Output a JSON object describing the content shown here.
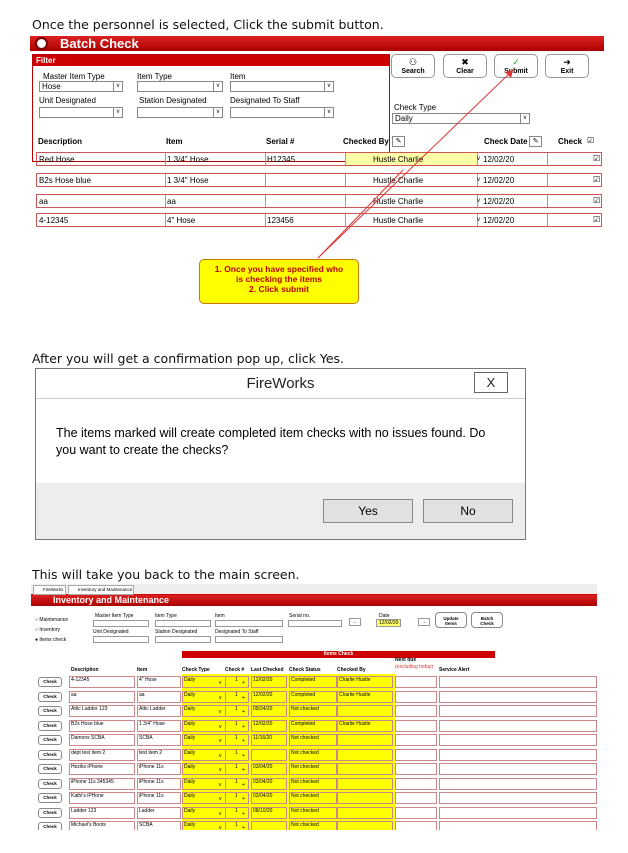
{
  "captions": {
    "c1": "Once the personnel is selected, Click the submit button.",
    "c2": "After you will get a confirmation pop up, click Yes.",
    "c3": "This will take you back to the main screen."
  },
  "batch": {
    "title": "Batch Check",
    "filter_title": "Filter",
    "labels": {
      "master": "Master Item Type",
      "item_type": "Item Type",
      "item": "Item",
      "unit": "Unit Designated",
      "station": "Station Designated",
      "staff": "Designated To Staff",
      "check_type": "Check Type"
    },
    "master_value": "Hose",
    "check_type_value": "Daily",
    "buttons": {
      "search": "Search",
      "clear": "Clear",
      "submit": "Submit",
      "exit": "Exit"
    },
    "headers": {
      "description": "Description",
      "item": "Item",
      "serial": "Serial #",
      "checked_by": "Checked By",
      "check_date": "Check Date",
      "check": "Check"
    },
    "rows": [
      {
        "description": "Red Hose",
        "item": "1 3/4\" Hose",
        "serial": "H12345",
        "checked_by": "Hustle Charlie",
        "date": "12/02/20"
      },
      {
        "description": "B2s Hose blue",
        "item": "1 3/4\" Hose",
        "serial": "",
        "checked_by": "Hustle Charlie",
        "date": "12/02/20"
      },
      {
        "description": "aa",
        "item": "aa",
        "serial": "",
        "checked_by": "Hustle Charlie",
        "date": "12/02/20"
      },
      {
        "description": "4-12345",
        "item": "4\" Hose",
        "serial": "123456",
        "checked_by": "Hustle Charlie",
        "date": "12/02/20"
      }
    ],
    "callout": {
      "line1": "1. Once you have specified who",
      "line2": "is checking the items",
      "line3": "2. Click submit"
    }
  },
  "dialog": {
    "title": "FireWorks",
    "close": "X",
    "message": "The items marked will create completed item checks with no issues found. Do you want to create the checks?",
    "yes": "Yes",
    "no": "No"
  },
  "main": {
    "tabs": [
      "FireWorks",
      "Inventory and Maintenance"
    ],
    "title": "Inventory and Maintenance",
    "radios": [
      "Maintenance",
      "Inventory",
      "Items check"
    ],
    "labels": {
      "master": "Master Item Type",
      "item_type": "Item Type",
      "item": "Item",
      "serial": "Serial no.",
      "date": "Date",
      "unit": "Unit Designated",
      "station": "Station Designated",
      "staff": "Designated To Staff"
    },
    "date_value": "12/02/20",
    "buttons": {
      "update1": "Update",
      "update2": "Items",
      "batch1": "Batch",
      "batch2": "Check"
    },
    "items_check": "Items Check",
    "headers": {
      "description": "Description",
      "item": "Item",
      "check_type": "Check Type",
      "check_num": "Check #",
      "last": "Last Checked",
      "status": "Check Status",
      "by": "Checked By",
      "next1": "Next due",
      "next2": "(excluding today)",
      "alert": "Service Alert"
    },
    "check_label": "Check",
    "rows": [
      {
        "description": "4-12345",
        "item": "4\" Hose",
        "type": "Daily",
        "num": "1",
        "last": "12/02/20",
        "status": "Completed",
        "by": "Charlie Hustle"
      },
      {
        "description": "aa",
        "item": "aa",
        "type": "Daily",
        "num": "1",
        "last": "12/02/20",
        "status": "Completed",
        "by": "Charlie Hustle"
      },
      {
        "description": "Attic Ladder 123",
        "item": "Attic Ladder",
        "type": "Daily",
        "num": "1",
        "last": "09/24/20",
        "status": "Not checked",
        "by": ""
      },
      {
        "description": "B2s Hose blue",
        "item": "1 3/4\" Hose",
        "type": "Daily",
        "num": "1",
        "last": "12/02/20",
        "status": "Completed",
        "by": "Charlie Hustle"
      },
      {
        "description": "Damons SCBA",
        "item": "SCBA",
        "type": "Daily",
        "num": "1",
        "last": "11/16/20",
        "status": "Not checked",
        "by": ""
      },
      {
        "description": "dept test item 2",
        "item": "test item 2",
        "type": "Daily",
        "num": "1",
        "last": "",
        "status": "Not checked",
        "by": ""
      },
      {
        "description": "Heziks iPhone",
        "item": "iPhone 11s",
        "type": "Daily",
        "num": "1",
        "last": "03/04/20",
        "status": "Not checked",
        "by": ""
      },
      {
        "description": "iPhone 11s 345345",
        "item": "iPhone 11s",
        "type": "Daily",
        "num": "1",
        "last": "03/04/20",
        "status": "Not checked",
        "by": ""
      },
      {
        "description": "Kathi's iPHone",
        "item": "iPhone 11s",
        "type": "Daily",
        "num": "1",
        "last": "03/04/20",
        "status": "Not checked",
        "by": ""
      },
      {
        "description": "Ladder 123",
        "item": "Ladder",
        "type": "Daily",
        "num": "1",
        "last": "08/10/20",
        "status": "Not checked",
        "by": ""
      },
      {
        "description": "Michael's Boots",
        "item": "SCBA",
        "type": "Daily",
        "num": "1",
        "last": "",
        "status": "Not checked",
        "by": ""
      }
    ]
  }
}
